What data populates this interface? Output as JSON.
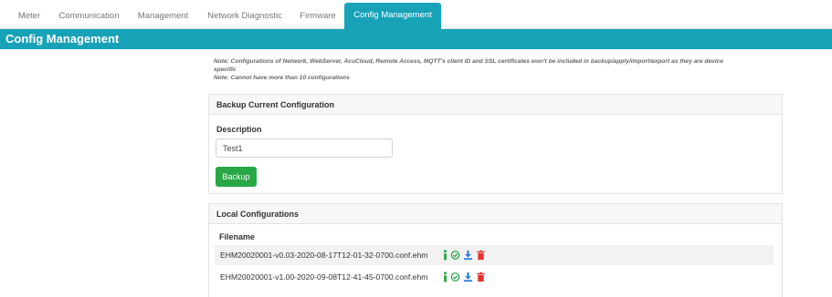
{
  "tabs": [
    {
      "label": "Meter",
      "active": false
    },
    {
      "label": "Communication",
      "active": false
    },
    {
      "label": "Management",
      "active": false
    },
    {
      "label": "Network Diagnostic",
      "active": false
    },
    {
      "label": "Firmware",
      "active": false
    },
    {
      "label": "Config Management",
      "active": true
    }
  ],
  "page": {
    "title": "Config Management",
    "note1": "Note: Configurations of Network, WebServer, AcuCloud, Remote Access, MQTT's client ID and SSL certificates won't be included in backup/apply/import/export as they are device",
    "note1_cont": "specific",
    "note2": "Note: Cannot have more than 10 configurations"
  },
  "backup": {
    "heading": "Backup Current Configuration",
    "description_label": "Description",
    "description_value": "Test1",
    "button_label": "Backup"
  },
  "local": {
    "heading": "Local Configurations",
    "column_filename": "Filename",
    "rows": [
      {
        "filename": "EHM20020001-v0.03-2020-08-17T12-01-32-0700.conf.ehm"
      },
      {
        "filename": "EHM20020001-v1.00-2020-09-08T12-41-45-0700.conf.ehm"
      }
    ]
  },
  "colors": {
    "accent": "#17a2b8",
    "info_icon": "#28a745",
    "apply_icon": "#28a745",
    "download_icon": "#2f7fd8",
    "delete_icon": "#e3342f",
    "backup_button": "#28a745"
  },
  "icons": [
    "info-icon",
    "apply-check-icon",
    "download-icon",
    "delete-trash-icon"
  ]
}
